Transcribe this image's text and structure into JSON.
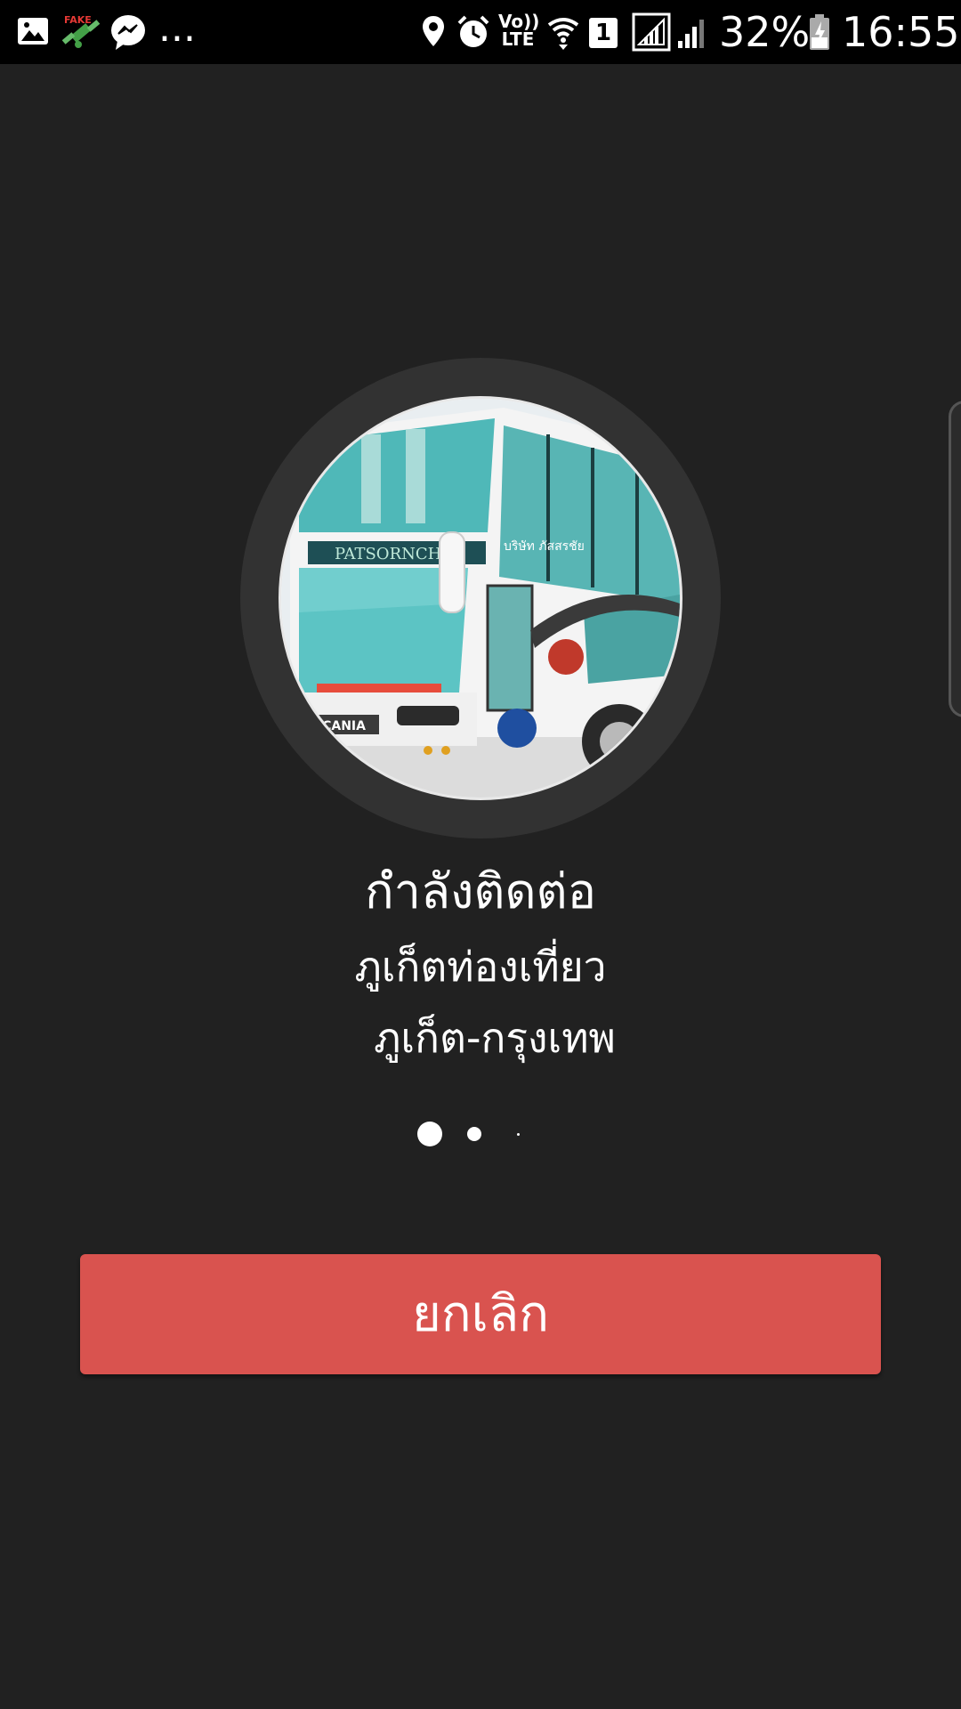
{
  "status_bar": {
    "time": "16:55",
    "battery_percent": "32%",
    "ellipsis": "...",
    "sim_slot": "1",
    "volte_label_top": "Vo))",
    "volte_label_bottom": "LTE",
    "fake_label": "FAKE",
    "left_icons": [
      "gallery-icon",
      "fake-gps-icon",
      "messenger-icon"
    ],
    "right_icons": [
      "location-icon",
      "alarm-icon",
      "volte-icon",
      "wifi-icon",
      "sim-icon",
      "signal-icon",
      "signal-icon-2",
      "battery-icon"
    ]
  },
  "connecting": {
    "status_title": "กำลังติดต่อ",
    "company_name": "ภูเก็ตท่องเที่ยว",
    "route_name": "ภูเก็ต-กรุงเทพ"
  },
  "avatar": {
    "icon": "bus-photo",
    "bus_text": "PATSORNCHAI",
    "bus_brand": "SCANIA",
    "bus_colors": {
      "body": "#f2f2f2",
      "window": "#4fb8b8",
      "accent": "#c0392b"
    }
  },
  "progress_dots": {
    "count": 3,
    "active_index": 0
  },
  "cancel_button": {
    "label": "ยกเลิก",
    "color": "#d9534f"
  },
  "colors": {
    "background": "#212121",
    "status_bar": "#000000",
    "ring": "#323232"
  }
}
